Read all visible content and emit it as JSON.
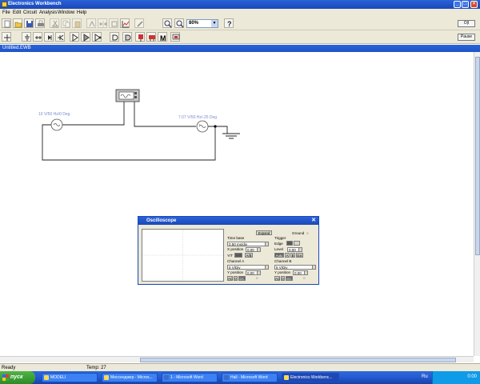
{
  "window": {
    "title": "Electronics Workbench"
  },
  "menu": [
    "File",
    "Edit",
    "Circuit",
    "Analysis",
    "Window",
    "Help"
  ],
  "toolbar": {
    "zoom_value": "80%",
    "right_btn1": "O|I",
    "right_btn2": "Pause"
  },
  "document": {
    "title": "Untitled.EWB"
  },
  "circuit": {
    "source1_label": "10 V/50 Hz/0 Deg",
    "source2_label": "7.07 V/50 Hz/-25 Deg"
  },
  "oscilloscope": {
    "title": "Oscilloscope",
    "expand": "Expand",
    "ground": "Ground",
    "time_base_label": "Time base",
    "time_base_value": "0.50 ms/div",
    "x_position_label": "X position",
    "x_position_value": "0.00",
    "yt": "Y/T",
    "ab": "A/B",
    "trigger_label": "Trigger",
    "edge_label": "Edge",
    "level_label": "Level",
    "level_value": "0.00",
    "auto": "Auto",
    "a": "A",
    "b": "B",
    "ext": "Ext",
    "channel_a_label": "Channel A",
    "channel_a_value": "5 V/Div",
    "channel_b_label": "Channel B",
    "channel_b_value": "5 V/Div",
    "y_position_label": "Y position",
    "y_position_a": "0.00",
    "y_position_b": "0.00",
    "ac": "AC",
    "zero": "0",
    "dc": "DC"
  },
  "status": {
    "ready": "Ready",
    "temp": "Temp: 27"
  },
  "taskbar": {
    "start": "пуск",
    "tasks": [
      "MODELI",
      "Мессенджер - Micros...",
      "1 - Microsoft Word",
      "Hall - Microsoft Word",
      "Electronics Workbenc..."
    ],
    "lang": "Ru",
    "clock": "0:00"
  },
  "colors": {
    "titlebar": "#2a62d8",
    "chrome": "#ece9d8",
    "taskbar": "#245dd7",
    "start": "#2d8a27"
  },
  "icons": [
    "new-icon",
    "open-icon",
    "save-icon",
    "print-icon",
    "cut-icon",
    "copy-icon",
    "paste-icon",
    "rotate-icon",
    "flip-icon",
    "subcircuit-icon",
    "graph-icon",
    "component-props-icon",
    "zoom-in-icon",
    "zoom-out-icon",
    "help-icon"
  ]
}
